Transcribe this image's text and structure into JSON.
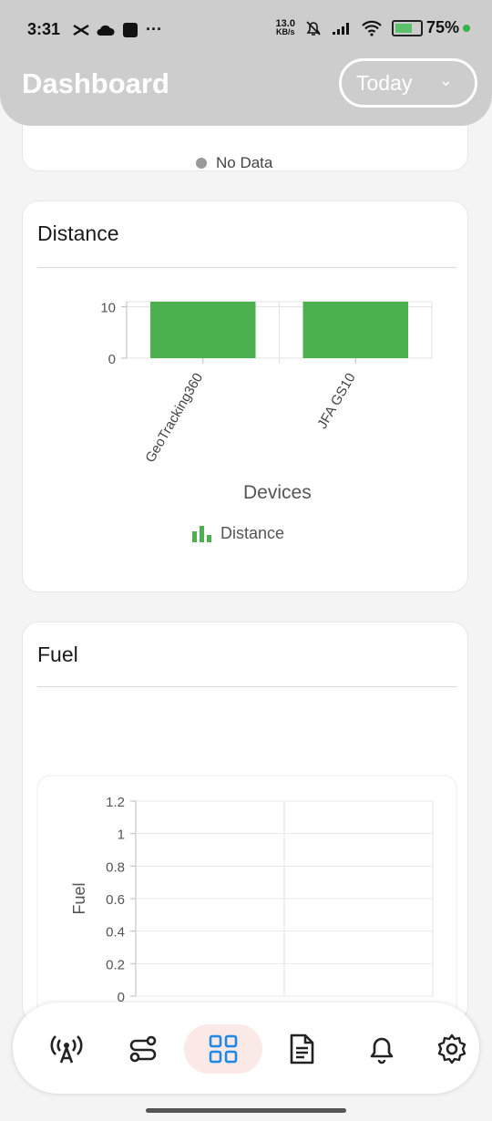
{
  "status_bar": {
    "time": "3:31",
    "net_speed_value": "13.0",
    "net_speed_unit": "KB/s",
    "battery": "75%"
  },
  "header": {
    "title": "Dashboard",
    "range_value": "Today"
  },
  "status_card": {
    "legend": "No Data"
  },
  "distance_card": {
    "title": "Distance",
    "chart_data": {
      "type": "bar",
      "categories": [
        "GeoTracking360",
        "JFA GS10"
      ],
      "series": [
        {
          "name": "Distance",
          "values": [
            11,
            11
          ]
        }
      ],
      "xlabel": "Devices",
      "ylabel": "",
      "yticks": [
        "10",
        "0"
      ],
      "ylim": [
        0,
        11
      ],
      "color": "#4caf50",
      "grid": true
    }
  },
  "fuel_card": {
    "title": "Fuel",
    "chart_data": {
      "type": "bar",
      "categories": [],
      "series": [],
      "ylabel": "Fuel",
      "yticks": [
        "1.2",
        "1",
        "0.8",
        "0.6",
        "0.4",
        "0.2",
        "0"
      ],
      "ylim": [
        0,
        1.2
      ],
      "grid": true
    }
  },
  "nav": {
    "items": [
      {
        "icon": "tracking-antenna-icon"
      },
      {
        "icon": "route-icon"
      },
      {
        "icon": "dashboard-grid-icon",
        "active": true
      },
      {
        "icon": "report-document-icon"
      },
      {
        "icon": "bell-icon"
      },
      {
        "icon": "settings-gear-icon"
      }
    ]
  },
  "colors": {
    "header_bg": "#cdcdcd",
    "bar_green": "#4caf50",
    "active_nav_bg": "#fbe9e7",
    "active_nav_icon": "#1e88e5"
  }
}
